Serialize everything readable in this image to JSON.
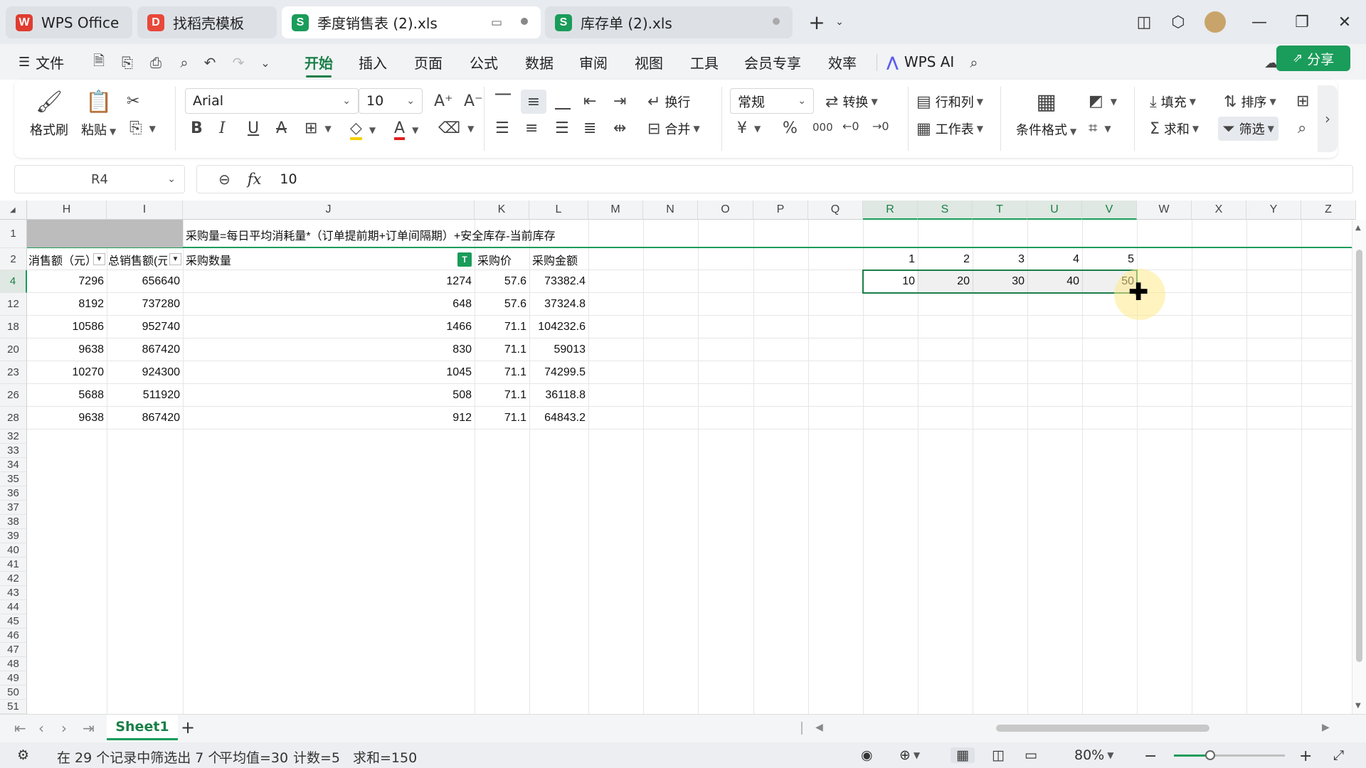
{
  "titlebar": {
    "tabs": [
      {
        "label": "WPS Office",
        "logo": "W",
        "color": "#e03c31"
      },
      {
        "label": "找稻壳模板",
        "logo": "D",
        "color": "#e8483b"
      },
      {
        "label": "季度销售表 (2).xls",
        "logo": "S",
        "color": "#1a9c5a"
      },
      {
        "label": "库存单 (2).xls",
        "logo": "S",
        "color": "#1a9c5a"
      }
    ],
    "new_tab": "+"
  },
  "menubar": {
    "file_label": "文件",
    "items": [
      "开始",
      "插入",
      "页面",
      "公式",
      "数据",
      "审阅",
      "视图",
      "工具",
      "会员专享",
      "效率"
    ],
    "wps_ai": "WPS AI",
    "share": "分享"
  },
  "ribbon": {
    "format_painter": "格式刷",
    "paste": "粘贴",
    "font_name": "Arial",
    "font_size": "10",
    "wrap": "换行",
    "merge": "合并",
    "number_format": "常规",
    "convert": "转换",
    "row_col": "行和列",
    "worksheet": "工作表",
    "cond_format": "条件格式",
    "fill": "填充",
    "sort": "排序",
    "sum": "求和",
    "filter": "筛选",
    "currency": "¥",
    "percent": "%",
    "thousands": "000"
  },
  "formula": {
    "cell_ref": "R4",
    "fx": "fx",
    "value": "10"
  },
  "grid": {
    "columns": [
      "H",
      "I",
      "J",
      "K",
      "L",
      "M",
      "N",
      "O",
      "P",
      "Q",
      "R",
      "S",
      "T",
      "U",
      "V",
      "W",
      "X",
      "Y",
      "Z"
    ],
    "rows": [
      "1",
      "2",
      "4",
      "12",
      "18",
      "20",
      "23",
      "26",
      "28",
      "32",
      "33",
      "34",
      "35",
      "36",
      "37",
      "38",
      "39",
      "40",
      "41",
      "42",
      "43",
      "44",
      "45",
      "46",
      "47",
      "48",
      "49",
      "50",
      "51"
    ],
    "note_row1": "采购量=每日平均消耗量*（订单提前期+订单间隔期）+安全库存-当前库存",
    "headers": {
      "h": "消售额（元）",
      "i": "总销售额(元",
      "j": "采购数量",
      "k": "采购价",
      "l": "采购金额",
      "filter_mark": "T"
    },
    "data": [
      [
        "7296",
        "656640",
        "1274",
        "57.6",
        "73382.4"
      ],
      [
        "8192",
        "737280",
        "648",
        "57.6",
        "37324.8"
      ],
      [
        "10586",
        "952740",
        "1466",
        "71.1",
        "104232.6"
      ],
      [
        "9638",
        "867420",
        "830",
        "71.1",
        "59013"
      ],
      [
        "10270",
        "924300",
        "1045",
        "71.1",
        "74299.5"
      ],
      [
        "5688",
        "511920",
        "508",
        "71.1",
        "36118.8"
      ],
      [
        "9638",
        "867420",
        "912",
        "71.1",
        "64843.2"
      ]
    ],
    "r2_seq": [
      "1",
      "2",
      "3",
      "4",
      "5"
    ],
    "r4_seq": [
      "10",
      "20",
      "30",
      "40",
      "50"
    ]
  },
  "sheets": {
    "active": "Sheet1",
    "add": "+"
  },
  "status": {
    "text": "在 29 个记录中筛选出 7 个",
    "average": "平均值=30",
    "count": "计数=5",
    "sum": "求和=150",
    "zoom": "80%",
    "zoom_fraction": 0.33
  },
  "colors": {
    "accent": "#1a9c5a",
    "accent_dark": "#1a7f48"
  }
}
